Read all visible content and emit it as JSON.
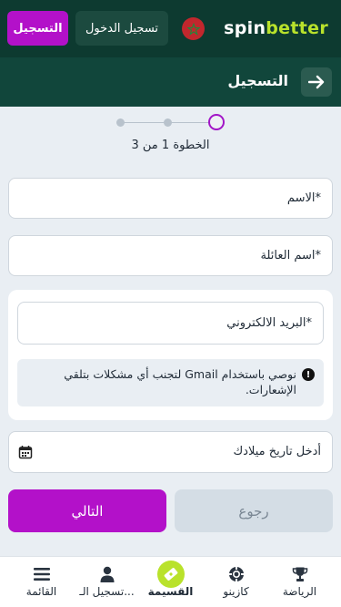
{
  "header": {
    "logo_part1": "spin",
    "logo_part2": "better",
    "register_label": "التسجيل",
    "login_label": "تسجيل الدخول",
    "flag_icon": "morocco-flag-icon"
  },
  "title_bar": {
    "title": "التسجيل",
    "back_icon": "arrow-right-icon"
  },
  "stepper": {
    "total_steps": 3,
    "current_step": 1,
    "text": "الخطوة 1 من 3"
  },
  "form": {
    "first_name_placeholder": "الاسم*",
    "last_name_placeholder": "اسم العائلة*",
    "email_placeholder": "البريد الالكتروني*",
    "gmail_notice": "نوصي باستخدام Gmail لتجنب أي مشكلات بتلقي الإشعارات.",
    "birthdate_placeholder": "أدخل تاريخ ميلادك"
  },
  "actions": {
    "next_label": "التالي",
    "back_label": "رجوع"
  },
  "bottom_nav": {
    "items": [
      {
        "label": "القائمة",
        "icon": "menu-icon"
      },
      {
        "label": "تسجيل الـ...",
        "icon": "user-icon"
      },
      {
        "label": "القسيمة",
        "icon": "coupon-icon"
      },
      {
        "label": "كازينو",
        "icon": "casino-chip-icon"
      },
      {
        "label": "الرياضة",
        "icon": "trophy-icon"
      }
    ]
  },
  "colors": {
    "primary_purple": "#b311c9",
    "header_green": "#0d3a30",
    "accent_lime": "#b9e22b"
  }
}
